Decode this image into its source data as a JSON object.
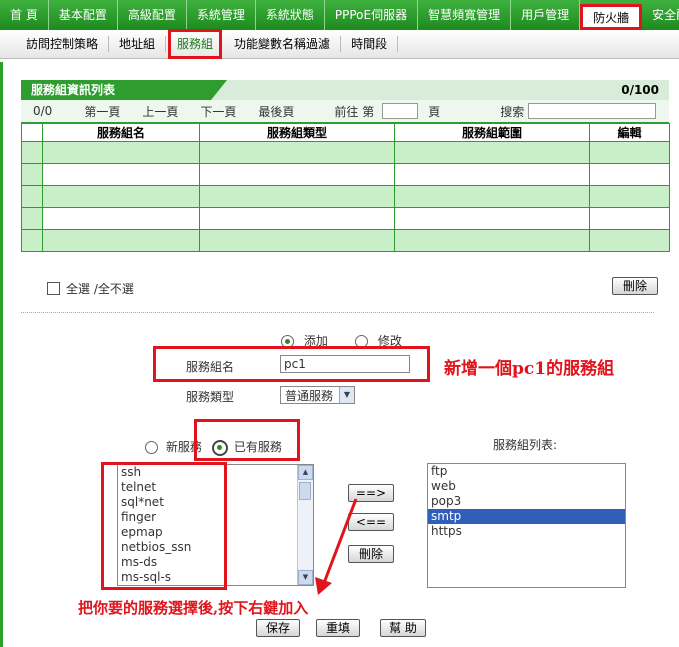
{
  "topnav": {
    "items": [
      "首 頁",
      "基本配置",
      "高級配置",
      "系統管理",
      "系統狀態",
      "PPPoE伺服器",
      "智慧頻寬管理",
      "用戶管理",
      "防火牆",
      "安全配"
    ],
    "active_index": 8
  },
  "subnav": {
    "items": [
      "訪問控制策略",
      "地址組",
      "服務組",
      "功能變數名稱過濾",
      "時間段"
    ],
    "active_index": 2
  },
  "list_panel": {
    "title": "服務組資訊列表",
    "count": "0/100",
    "pager": {
      "position": "0/0",
      "first": "第一頁",
      "prev": "上一頁",
      "next": "下一頁",
      "last": "最後頁",
      "goto_prefix": "前往 第",
      "goto_suffix": "頁",
      "search_label": "搜索"
    },
    "columns": [
      "",
      "服務組名",
      "服務組類型",
      "服務組範圍",
      "編輯"
    ]
  },
  "select_all": {
    "select": "全選",
    "deselect": "/全不選"
  },
  "delete_button": "刪除",
  "form": {
    "mode_add": "添加",
    "mode_edit": "修改",
    "name_label": "服務組名",
    "name_value": "pc1",
    "type_label": "服務類型",
    "type_value": "普通服務",
    "new_service": "新服務",
    "existing_service": "已有服務",
    "group_list_label": "服務組列表:",
    "available_services": [
      "ssh",
      "telnet",
      "sql*net",
      "finger",
      "epmap",
      "netbios_ssn",
      "ms-ds",
      "ms-sql-s"
    ],
    "group_services": [
      "ftp",
      "web",
      "pop3",
      "smtp",
      "https"
    ],
    "selected_group_service": "smtp",
    "add_button": "==>",
    "remove_button": "<==",
    "delete_button": "刪除",
    "save_button": "保存",
    "reset_button": "重填",
    "help_button": "幫 助"
  },
  "annotations": {
    "note_name": "新增一個pc1的服務組",
    "note_add": "把你要的服務選擇後,按下右鍵加入"
  },
  "colors": {
    "nav_green": "#1e8a1e",
    "highlight_red": "#e0141c",
    "row_green": "#c9efc9",
    "selection_blue": "#2f5fb8"
  }
}
